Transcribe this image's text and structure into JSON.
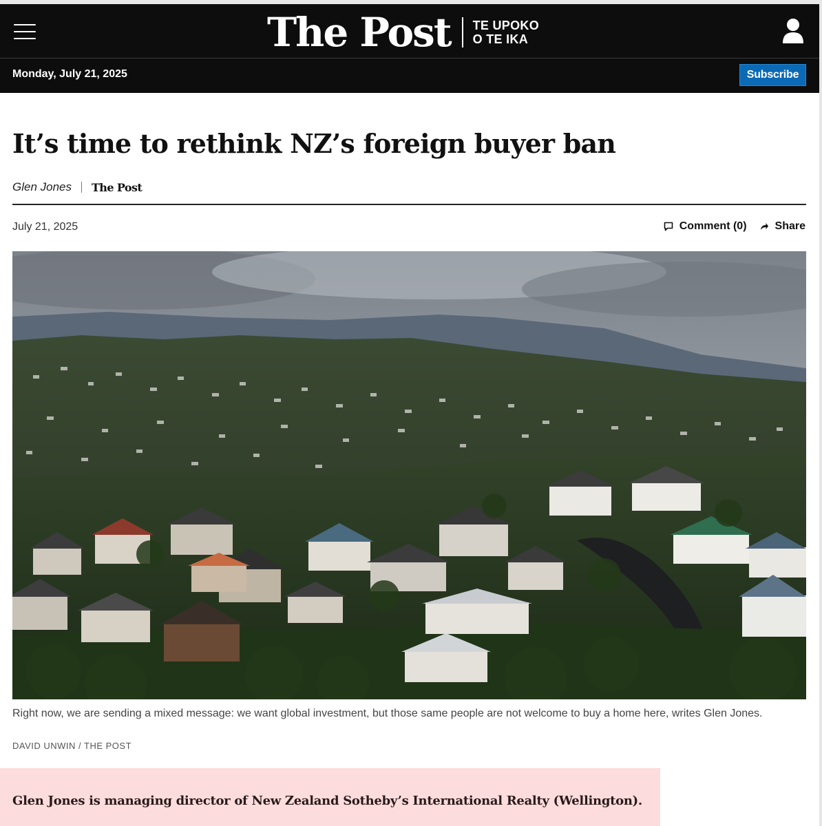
{
  "header": {
    "logo": "The Post",
    "maori_line1": "TE UPOKO",
    "maori_line2": "O TE IKA",
    "date": "Monday, July 21, 2025",
    "subscribe_label": "Subscribe",
    "menu_icon": "hamburger-menu-icon",
    "account_icon": "user-account-icon"
  },
  "article": {
    "headline": "It’s time to rethink NZ’s foreign buyer ban",
    "author": "Glen Jones",
    "publication": "The Post",
    "date": "July 21, 2025",
    "comment_label": "Comment (0)",
    "share_label": "Share",
    "comment_icon": "comment-bubble-icon",
    "share_icon": "share-arrow-icon",
    "caption": "Right now, we are sending a mixed message: we want global investment, but those same people are not welcome to buy a home here, writes Glen Jones.",
    "credit": "DAVID UNWIN / THE POST",
    "bio": "Glen Jones is managing director of New Zealand Sotheby’s International Realty (Wellington)."
  },
  "colors": {
    "header_bg": "#0d0d0d",
    "subscribe_bg": "#0a6ab6",
    "bio_bg": "#fcdcdc"
  }
}
